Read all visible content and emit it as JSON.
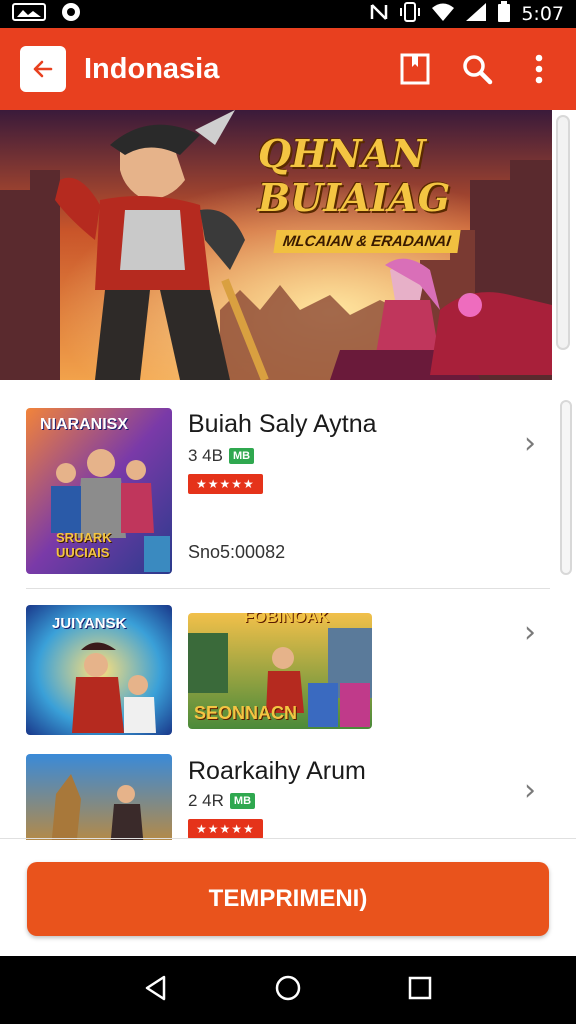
{
  "status_bar": {
    "time": "5:07"
  },
  "app_bar": {
    "title": "Indonasia"
  },
  "banner": {
    "headline": "QHNAN BUIAIAG",
    "subline": "MLCAIAN & ERADANAI"
  },
  "list": [
    {
      "thumb_label_top": "NIARANISX",
      "thumb_label_bottom": "SRUARK UUCIAIS",
      "title": "Buiah Saly Aytna",
      "meta": "3 4B",
      "badge": "MB",
      "rating": "★★★★★",
      "price": "Sno5:00082"
    },
    {
      "thumb_label_top": "JUIYANSK",
      "thumb2_label_top": "FOBINOAK",
      "thumb2_label_bottom": "SEONNACN"
    },
    {
      "title": "Roarkaihy Arum",
      "meta": "2 4R",
      "badge": "MB",
      "rating": "★★★★★"
    }
  ],
  "cta": {
    "label": "TEMPRIMENI)"
  },
  "colors": {
    "primary": "#e8401f",
    "cta": "#e9531c",
    "rating": "#e5331a",
    "badge": "#2fa84f"
  }
}
